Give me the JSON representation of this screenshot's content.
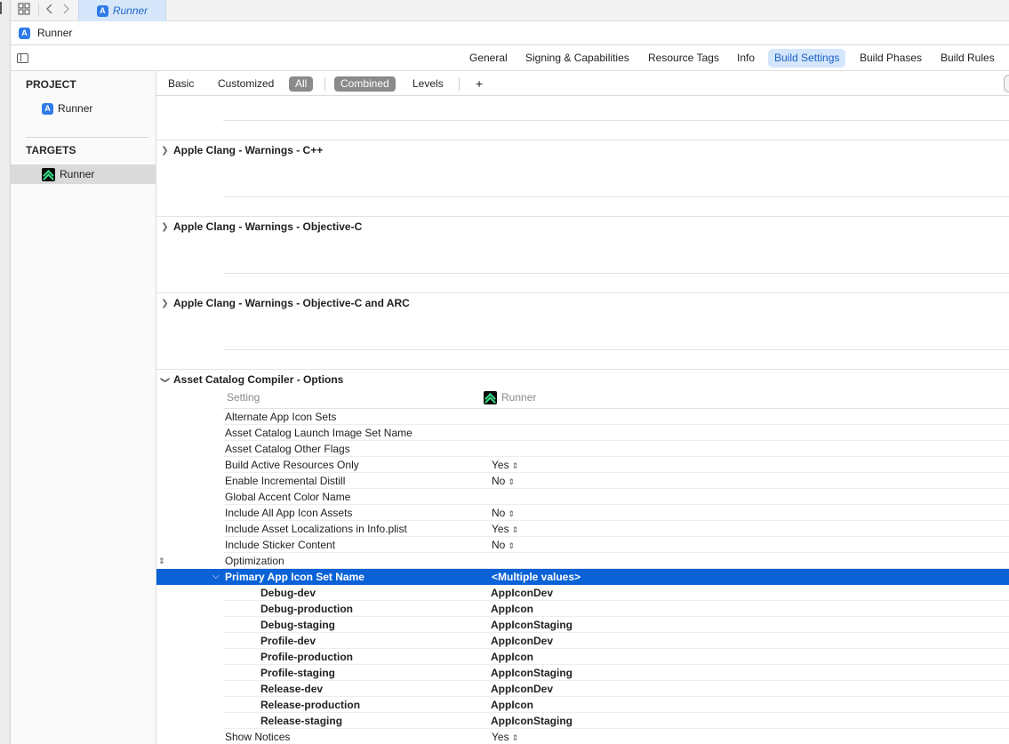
{
  "window": {
    "file_tab": "Runner",
    "breadcrumb": "Runner"
  },
  "editor_tabs": [
    "General",
    "Signing & Capabilities",
    "Resource Tags",
    "Info",
    "Build Settings",
    "Build Phases",
    "Build Rules"
  ],
  "editor_tabs_active": "Build Settings",
  "navigator": {
    "project_header": "PROJECT",
    "project_item": "Runner",
    "targets_header": "TARGETS",
    "target_item": "Runner"
  },
  "filter_bar": {
    "basic": "Basic",
    "customized": "Customized",
    "all": "All",
    "combined": "Combined",
    "levels": "Levels",
    "add": "+"
  },
  "sections": [
    {
      "title": "Apple Clang - Warnings - C++",
      "expanded": false
    },
    {
      "title": "Apple Clang - Warnings - Objective-C",
      "expanded": false
    },
    {
      "title": "Apple Clang - Warnings - Objective-C and ARC",
      "expanded": false
    },
    {
      "title": "Asset Catalog Compiler - Options",
      "expanded": true
    }
  ],
  "column_headers": {
    "setting": "Setting",
    "target": "Runner"
  },
  "settings": [
    {
      "name": "Alternate App Icon Sets",
      "value": ""
    },
    {
      "name": "Asset Catalog Launch Image Set Name",
      "value": ""
    },
    {
      "name": "Asset Catalog Other Flags",
      "value": ""
    },
    {
      "name": "Build Active Resources Only",
      "value": "Yes"
    },
    {
      "name": "Enable Incremental Distill",
      "value": "No"
    },
    {
      "name": "Global Accent Color Name",
      "value": ""
    },
    {
      "name": "Include All App Icon Assets",
      "value": "No"
    },
    {
      "name": "Include Asset Localizations in Info.plist",
      "value": "Yes"
    },
    {
      "name": "Include Sticker Content",
      "value": "No"
    },
    {
      "name": "Optimization",
      "value": ""
    },
    {
      "name": "Primary App Icon Set Name",
      "value": "<Multiple values>"
    },
    {
      "name": "Debug-dev",
      "value": "AppIconDev"
    },
    {
      "name": "Debug-production",
      "value": "AppIcon"
    },
    {
      "name": "Debug-staging",
      "value": "AppIconStaging"
    },
    {
      "name": "Profile-dev",
      "value": "AppIconDev"
    },
    {
      "name": "Profile-production",
      "value": "AppIcon"
    },
    {
      "name": "Profile-staging",
      "value": "AppIconStaging"
    },
    {
      "name": "Release-dev",
      "value": "AppIconDev"
    },
    {
      "name": "Release-production",
      "value": "AppIcon"
    },
    {
      "name": "Release-staging",
      "value": "AppIconStaging"
    },
    {
      "name": "Show Notices",
      "value": "Yes"
    }
  ],
  "colors": {
    "selection": "#0b62d6",
    "active_tab_bg": "#d4e6fc",
    "active_tab_text": "#1c5fc4"
  }
}
